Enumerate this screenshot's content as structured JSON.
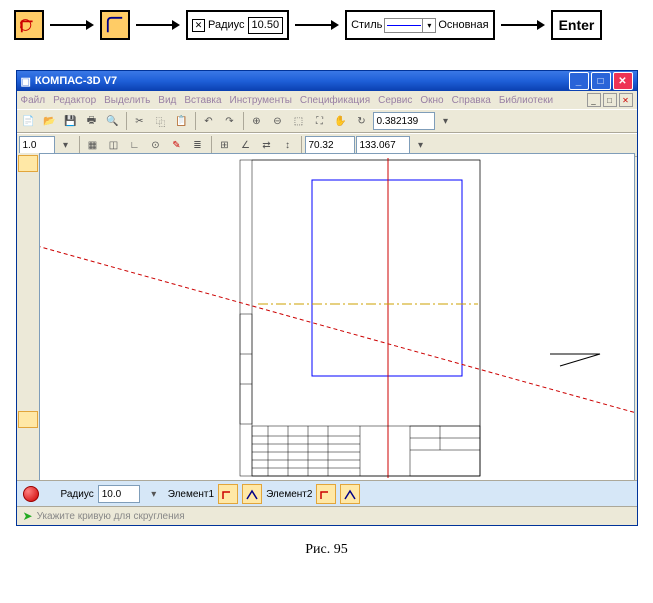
{
  "flow": {
    "radius_label": "Радиус",
    "radius_value": "10.50",
    "style_label": "Стиль",
    "style_name": "Основная",
    "enter_label": "Enter"
  },
  "app": {
    "title": "КОМПАС-3D V7",
    "menu": [
      "Файл",
      "Редактор",
      "Выделить",
      "Вид",
      "Вставка",
      "Инструменты",
      "Спецификация",
      "Сервис",
      "Окно",
      "Справка",
      "Библиотеки"
    ],
    "bottom_bar": {
      "radius_label": "Радиус",
      "radius_value": "10.0",
      "p1_label": "Элемент1",
      "p2_label": "Элемент2"
    },
    "status_text": "Укажите кривую для скругления",
    "view_field1": "0.382139",
    "view_field2": "70.32",
    "view_field3": "133.067"
  },
  "caption": "Рис. 95"
}
